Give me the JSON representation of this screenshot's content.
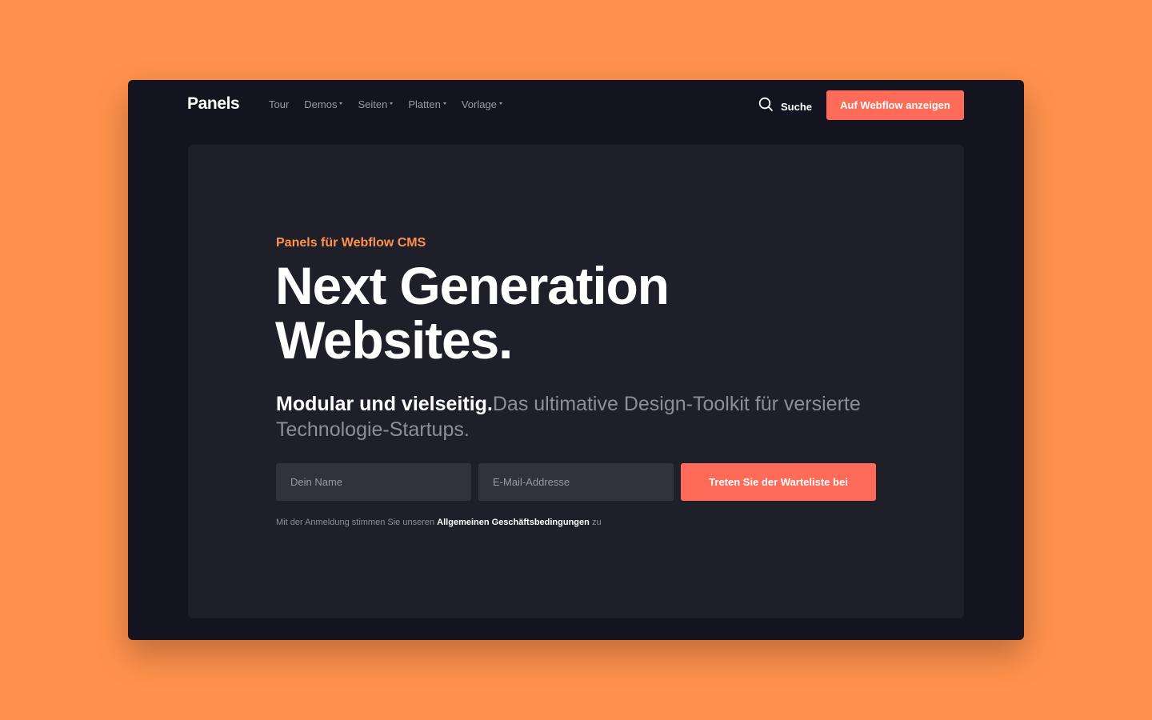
{
  "nav": {
    "logo": "Panels",
    "links": [
      {
        "label": "Tour",
        "has_dropdown": false
      },
      {
        "label": "Demos",
        "has_dropdown": true
      },
      {
        "label": "Seiten",
        "has_dropdown": true
      },
      {
        "label": "Platten",
        "has_dropdown": true
      },
      {
        "label": "Vorlage",
        "has_dropdown": true
      }
    ],
    "search_label": "Suche",
    "search_icon": "search-icon",
    "cta_label": "Auf Webflow anzeigen"
  },
  "hero": {
    "eyebrow": "Panels für Webflow CMS",
    "headline_line1": "Next Generation",
    "headline_line2": "Websites.",
    "subline_strong": "Modular und vielseitig.",
    "subline_rest": "Das ultimative Design-Toolkit für versierte Technologie-Startups.",
    "name_placeholder": "Dein Name",
    "email_placeholder": "E-Mail-Addresse",
    "join_label": "Treten Sie der Warteliste bei",
    "terms_prefix": "Mit der Anmeldung stimmen Sie unseren",
    "terms_link": "Allgemeinen Geschäftsbedingungen",
    "terms_suffix": "zu"
  },
  "colors": {
    "page_bg": "#FF914D",
    "window_bg": "#141420",
    "card_bg": "#1F1F2A",
    "accent": "#FF6B59",
    "eyebrow": "#FF914D",
    "input_bg": "#32323D"
  }
}
